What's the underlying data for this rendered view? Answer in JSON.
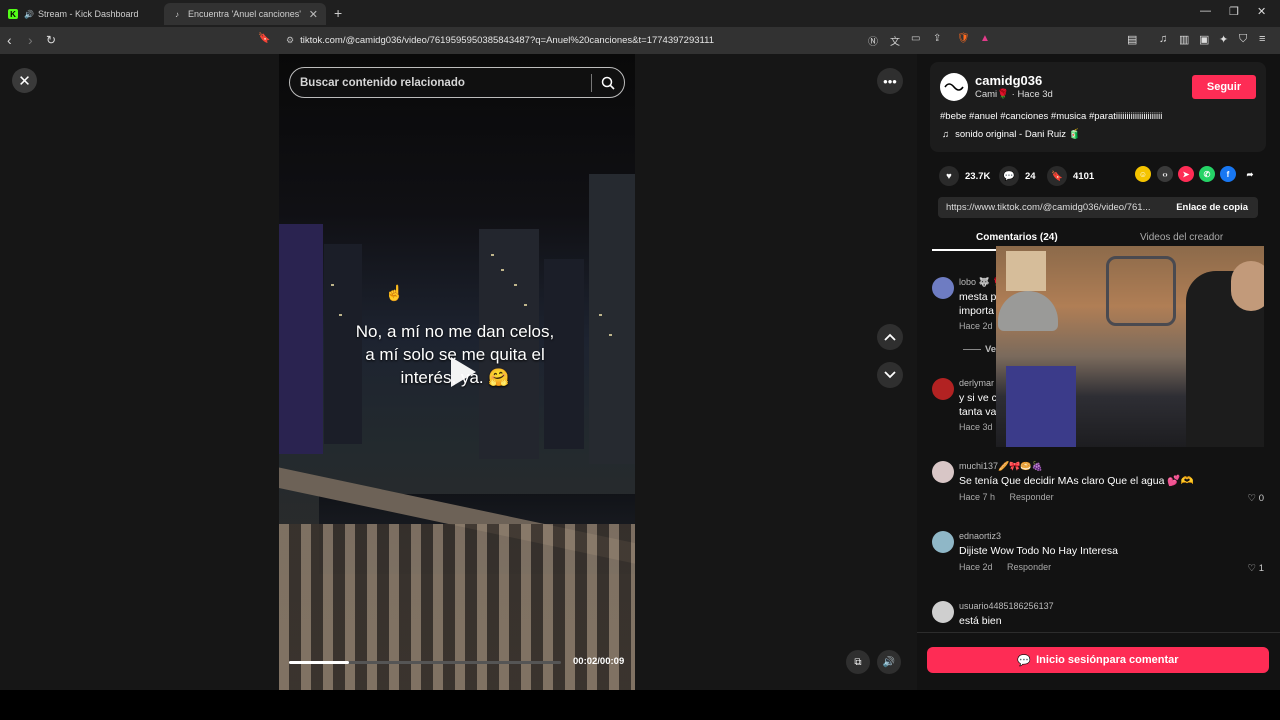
{
  "browser": {
    "tabs": [
      {
        "title": "Stream - Kick Dashboard"
      },
      {
        "title": "Encuentra 'Anuel canciones' en T"
      }
    ],
    "url": "tiktok.com/@camidg036/video/7619595950385843487?q=Anuel%20canciones&t=1774397293111"
  },
  "video": {
    "search_placeholder": "Buscar contenido relacionado",
    "caption_lines": [
      "No, a mí no me dan celos,",
      "a mí solo se me quita el",
      "interés, ya. 🤗"
    ],
    "time": "00:02/00:09",
    "progress": 0.22
  },
  "post": {
    "username": "camidg036",
    "subline": "Cami🌹 · Hace 3d",
    "follow_label": "Seguir",
    "hashtags": "#bebe #anuel #canciones #musica #paratiiiiiiiiiiiiiiiiiiiiii",
    "sound": "sonido original - Dani Ruiz 🧃",
    "likes": "23.7K",
    "comments": "24",
    "saves": "4101",
    "link": "https://www.tiktok.com/@camidg036/video/761...",
    "copy_label": "Enlace de copia"
  },
  "tabs": {
    "comments": "Comentarios (24)",
    "creator_videos": "Videos del creador"
  },
  "comments": [
    {
      "user": "lobo 🐺 🌹",
      "text": "mesta p",
      "text2": "importa",
      "time": "Hace 2d",
      "reply": "",
      "likes": "",
      "color": "#6e7cc2"
    },
    {
      "user": "derlymar",
      "text": "y si ve c",
      "text2": "tanta va",
      "time": "Hace 3d",
      "reply": "",
      "likes": "",
      "color": "#b22222"
    },
    {
      "user": "muchi137🥖🎀🥯🍇",
      "text": "Se tenía Que decidir MAs claro Que el agua 💕🫶",
      "text2": "",
      "time": "Hace 7 h",
      "reply": "Responder",
      "likes": "0",
      "color": "#d8c6c6"
    },
    {
      "user": "ednaortiz3",
      "text": "Dijiste Wow Todo No Hay Interesa",
      "text2": "",
      "time": "Hace 2d",
      "reply": "Responder",
      "likes": "1",
      "color": "#8fb7c7"
    },
    {
      "user": "usuario4485186256137",
      "text": "está bien",
      "text2": "",
      "time": "",
      "reply": "",
      "likes": "",
      "color": "#cfcfcf"
    }
  ],
  "view_replies_label": "Ve",
  "login_label": "Inicio sesiónpara comentar",
  "colors": {
    "accent": "#fe2c55",
    "panel": "#121212",
    "card": "#1c1c1c"
  }
}
